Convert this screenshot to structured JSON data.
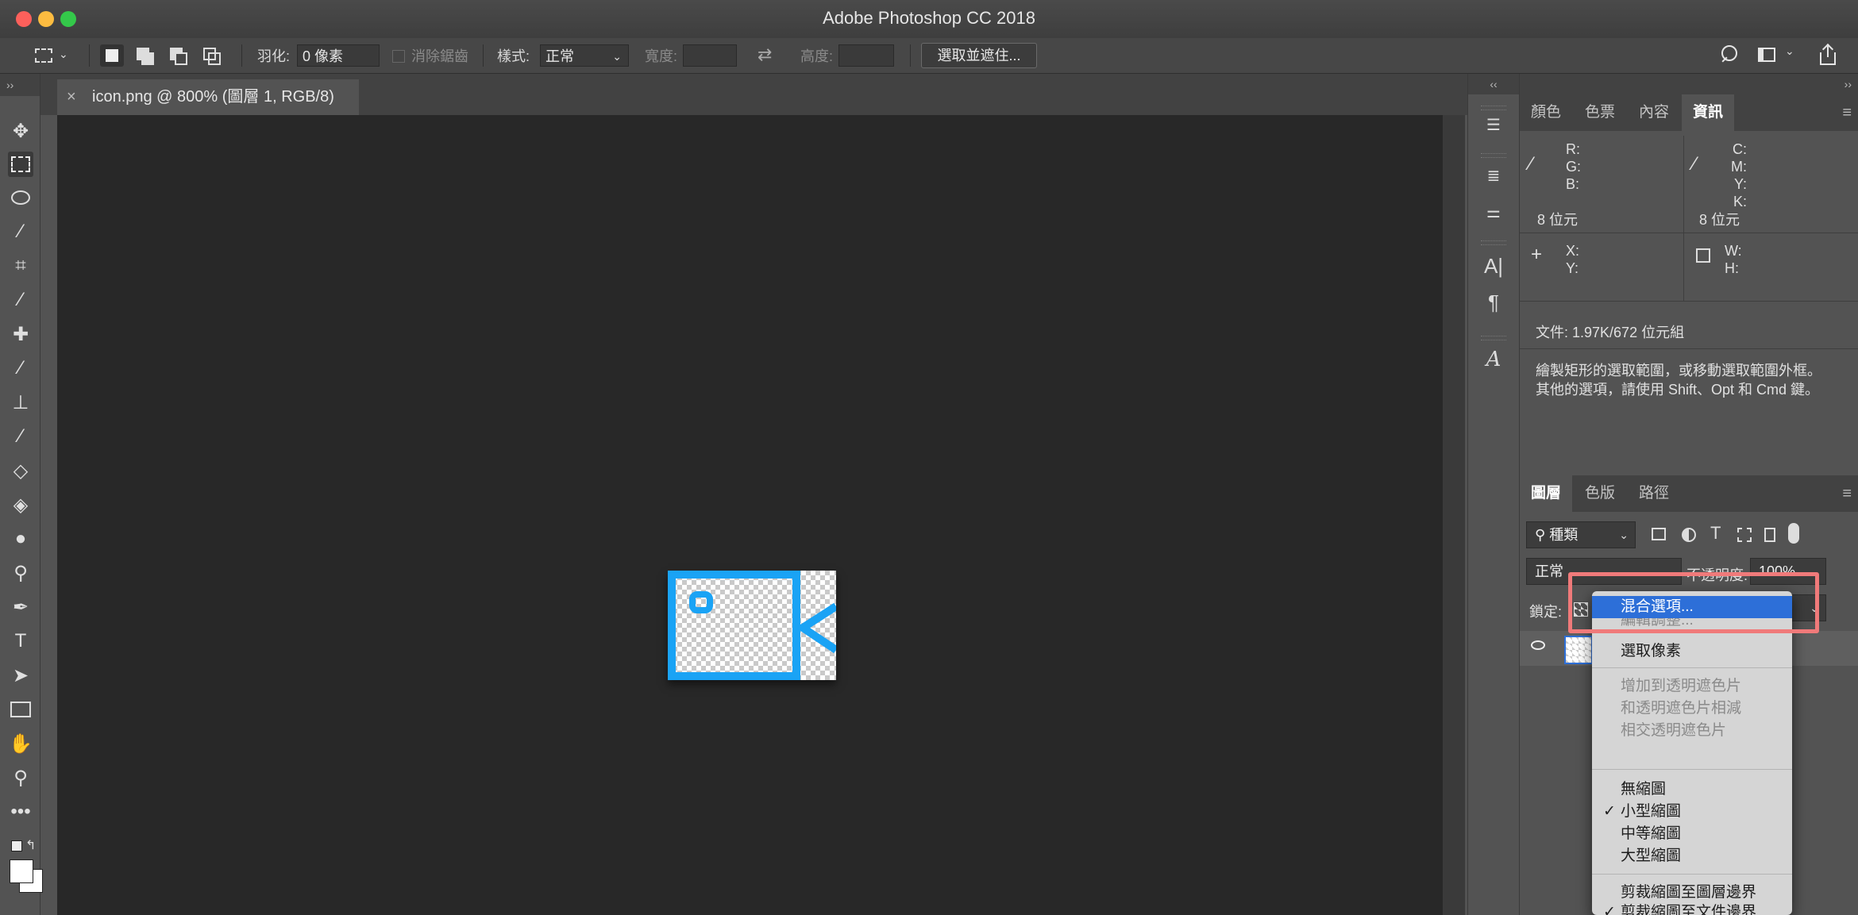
{
  "window": {
    "title": "Adobe Photoshop CC 2018"
  },
  "options_bar": {
    "feather_label": "羽化:",
    "feather_value": "0 像素",
    "antialias_label": "消除鋸齒",
    "style_label": "樣式:",
    "style_value": "正常",
    "width_label": "寬度:",
    "height_label": "高度:",
    "select_mask_button": "選取並遮住..."
  },
  "document": {
    "tab_close": "×",
    "tab_label": "icon.png @ 800% (圖層 1, RGB/8)",
    "image_colors": {
      "stroke": "#1aa3f5"
    }
  },
  "toolbar": {
    "expand": "››",
    "tools": [
      "move-icon",
      "marquee-icon",
      "lasso-icon",
      "magic-wand-icon",
      "crop-icon",
      "eyedropper-icon",
      "healing-icon",
      "brush-icon",
      "stamp-icon",
      "history-brush-icon",
      "eraser-icon",
      "bucket-icon",
      "blur-icon",
      "dodge-icon",
      "pen-icon",
      "type-icon",
      "path-select-icon",
      "rectangle-icon",
      "hand-icon",
      "zoom-icon",
      "more-icon"
    ],
    "type_tool_glyph": "T"
  },
  "icon_column": {
    "collapse": "‹‹",
    "char_glyph": "A|",
    "para_glyph": "¶",
    "glyph_glyph": "A"
  },
  "right_panel": {
    "expand": "››",
    "info_tabs": [
      "顏色",
      "色票",
      "內容",
      "資訊"
    ],
    "info_active_tab": "資訊",
    "rgb_labels": "R:\nG:\nB:",
    "cmyk_labels": "C:\nM:\nY:\nK:",
    "bits_left": "8 位元",
    "bits_right": "8 位元",
    "xy_labels": "X:\nY:",
    "wh_labels": "W:\nH:",
    "doc_info": "文件: 1.97K/672 位元組",
    "hint_line1": "繪製矩形的選取範圍，或移動選取範圍外框。",
    "hint_line2": "其他的選項，請使用 Shift、Opt 和 Cmd 鍵。",
    "layer_tabs": [
      "圖層",
      "色版",
      "路徑"
    ],
    "layer_active_tab": "圖層",
    "filter_value": "種類",
    "blend_value": "正常",
    "opacity_label": "不透明度:",
    "opacity_value": "100%",
    "lock_label": "鎖定:"
  },
  "context_menu": {
    "items": [
      {
        "label": "混合選項...",
        "state": "highlighted"
      },
      {
        "label": "編輯調整...",
        "state": "disabled"
      },
      {
        "label": "選取像素",
        "state": "normal"
      },
      {
        "label": "增加到透明遮色片",
        "state": "disabled"
      },
      {
        "label": "和透明遮色片相減",
        "state": "disabled"
      },
      {
        "label": "相交透明遮色片",
        "state": "disabled"
      },
      {
        "label": "無縮圖",
        "state": "normal"
      },
      {
        "label": "小型縮圖",
        "state": "checked"
      },
      {
        "label": "中等縮圖",
        "state": "normal"
      },
      {
        "label": "大型縮圖",
        "state": "normal"
      },
      {
        "label": "剪裁縮圖至圖層邊界",
        "state": "normal"
      },
      {
        "label": "剪裁縮圖至文件邊界",
        "state": "checked"
      }
    ],
    "check_glyph": "✓",
    "highlight_color": "#f07a7a"
  }
}
